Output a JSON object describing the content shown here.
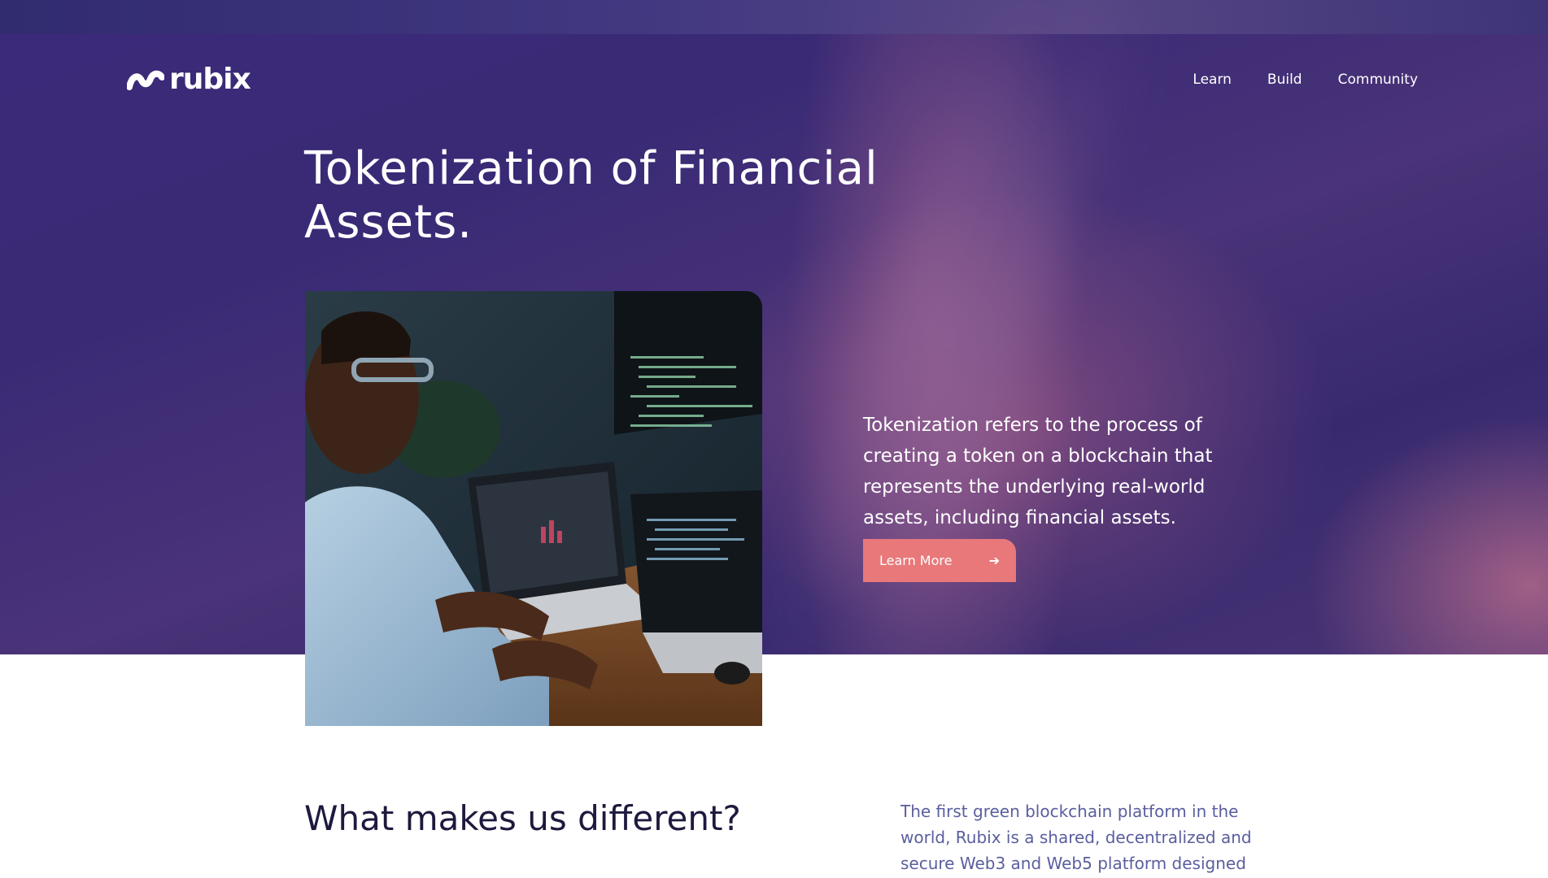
{
  "brand": {
    "name": "rubix",
    "accent": "#e8787a",
    "hero_bg": "#3b2a7a",
    "heading_dark": "#1d1a3e",
    "text_muted": "#5a5e9e"
  },
  "nav": {
    "items": [
      {
        "label": "Learn"
      },
      {
        "label": "Build"
      },
      {
        "label": "Community"
      }
    ]
  },
  "hero": {
    "title": "Tokenization of Financial Assets.",
    "description": "Tokenization refers to the process of creating a token on a blockchain that represents the underlying real-world assets, including financial assets.",
    "cta_label": "Learn More",
    "cta_icon": "arrow-right-icon"
  },
  "section": {
    "title": "What makes us different?",
    "description": "The first green blockchain platform in the world, Rubix is a shared, decentralized and secure Web3 and Web5 platform designed"
  }
}
